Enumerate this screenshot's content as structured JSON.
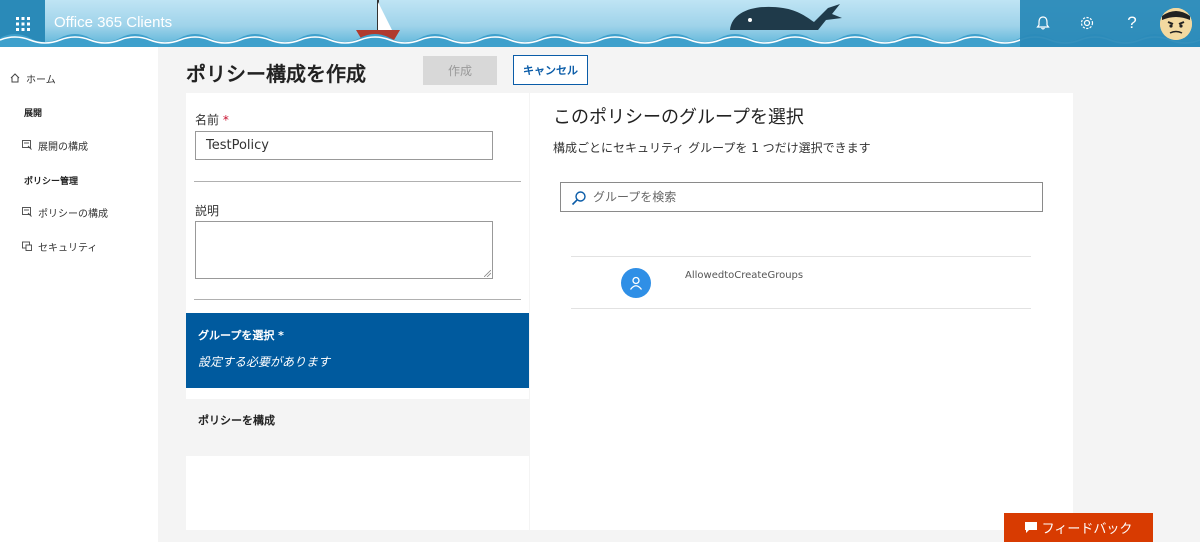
{
  "header": {
    "app_title": "Office 365 Clients",
    "icons": [
      "waffle-icon",
      "bell-icon",
      "gear-icon",
      "help-icon",
      "avatar"
    ],
    "colors": {
      "waffle_bg": "#2a8ab8",
      "sky": "#bfe4f4",
      "sea": "#58b3d8"
    }
  },
  "sidebar": {
    "home": "ホーム",
    "section_deploy": "展開",
    "deploy_config": "展開の構成",
    "section_policy": "ポリシー管理",
    "policy_config": "ポリシーの構成",
    "security": "セキュリティ"
  },
  "page": {
    "title": "ポリシー構成を作成",
    "create_button": "作成",
    "cancel_button": "キャンセル"
  },
  "form": {
    "name_label": "名前",
    "required_mark": "*",
    "name_value": "TestPolicy",
    "description_label": "説明",
    "description_value": ""
  },
  "steps": {
    "active_title": "グループを選択 *",
    "active_subtitle": "設定する必要があります",
    "next_title": "ポリシーを構成"
  },
  "group_panel": {
    "title": "このポリシーのグループを選択",
    "description": "構成ごとにセキュリティ グループを 1 つだけ選択できます",
    "search_placeholder": "グループを検索",
    "groups": [
      {
        "name": "AllowedtoCreateGroups"
      }
    ]
  },
  "feedback": {
    "label": "フィードバック",
    "color": "#d83b01"
  }
}
